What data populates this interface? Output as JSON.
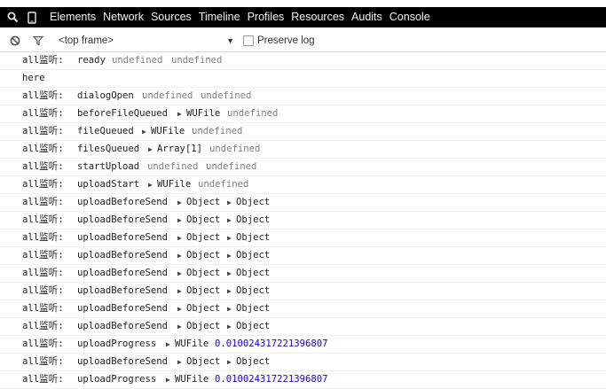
{
  "tabs": [
    "Elements",
    "Network",
    "Sources",
    "Timeline",
    "Profiles",
    "Resources",
    "Audits",
    "Console"
  ],
  "filter": {
    "frame": "<top frame>",
    "preserve_log_label": "Preserve log",
    "preserve_log_checked": false
  },
  "console_rows": [
    {
      "label": "all监听:",
      "event": "ready",
      "args": [
        {
          "text": "undefined",
          "kind": "undef"
        },
        {
          "text": "undefined",
          "kind": "undef"
        }
      ]
    },
    {
      "label": "here",
      "event": "",
      "args": []
    },
    {
      "label": "all监听:",
      "event": "dialogOpen",
      "args": [
        {
          "text": "undefined",
          "kind": "undef"
        },
        {
          "text": "undefined",
          "kind": "undef"
        }
      ]
    },
    {
      "label": "all监听:",
      "event": "beforeFileQueued",
      "args": [
        {
          "text": "WUFile",
          "kind": "object"
        },
        {
          "text": "undefined",
          "kind": "undef"
        }
      ]
    },
    {
      "label": "all监听:",
      "event": "fileQueued",
      "args": [
        {
          "text": "WUFile",
          "kind": "object"
        },
        {
          "text": "undefined",
          "kind": "undef"
        }
      ]
    },
    {
      "label": "all监听:",
      "event": "filesQueued",
      "args": [
        {
          "text": "Array[1]",
          "kind": "object"
        },
        {
          "text": "undefined",
          "kind": "undef"
        }
      ]
    },
    {
      "label": "all监听:",
      "event": "startUpload",
      "args": [
        {
          "text": "undefined",
          "kind": "undef"
        },
        {
          "text": "undefined",
          "kind": "undef"
        }
      ]
    },
    {
      "label": "all监听:",
      "event": "uploadStart",
      "args": [
        {
          "text": "WUFile",
          "kind": "object"
        },
        {
          "text": "undefined",
          "kind": "undef"
        }
      ]
    },
    {
      "label": "all监听:",
      "event": "uploadBeforeSend",
      "args": [
        {
          "text": "Object",
          "kind": "object"
        },
        {
          "text": "Object",
          "kind": "object"
        }
      ]
    },
    {
      "label": "all监听:",
      "event": "uploadBeforeSend",
      "args": [
        {
          "text": "Object",
          "kind": "object"
        },
        {
          "text": "Object",
          "kind": "object"
        }
      ]
    },
    {
      "label": "all监听:",
      "event": "uploadBeforeSend",
      "args": [
        {
          "text": "Object",
          "kind": "object"
        },
        {
          "text": "Object",
          "kind": "object"
        }
      ]
    },
    {
      "label": "all监听:",
      "event": "uploadBeforeSend",
      "args": [
        {
          "text": "Object",
          "kind": "object"
        },
        {
          "text": "Object",
          "kind": "object"
        }
      ]
    },
    {
      "label": "all监听:",
      "event": "uploadBeforeSend",
      "args": [
        {
          "text": "Object",
          "kind": "object"
        },
        {
          "text": "Object",
          "kind": "object"
        }
      ]
    },
    {
      "label": "all监听:",
      "event": "uploadBeforeSend",
      "args": [
        {
          "text": "Object",
          "kind": "object"
        },
        {
          "text": "Object",
          "kind": "object"
        }
      ]
    },
    {
      "label": "all监听:",
      "event": "uploadBeforeSend",
      "args": [
        {
          "text": "Object",
          "kind": "object"
        },
        {
          "text": "Object",
          "kind": "object"
        }
      ]
    },
    {
      "label": "all监听:",
      "event": "uploadBeforeSend",
      "args": [
        {
          "text": "Object",
          "kind": "object"
        },
        {
          "text": "Object",
          "kind": "object"
        }
      ]
    },
    {
      "label": "all监听:",
      "event": "uploadProgress",
      "args": [
        {
          "text": "WUFile",
          "kind": "object"
        },
        {
          "text": "0.010024317221396807",
          "kind": "number"
        }
      ]
    },
    {
      "label": "all监听:",
      "event": "uploadBeforeSend",
      "args": [
        {
          "text": "Object",
          "kind": "object"
        },
        {
          "text": "Object",
          "kind": "object"
        }
      ]
    },
    {
      "label": "all监听:",
      "event": "uploadProgress",
      "args": [
        {
          "text": "WUFile",
          "kind": "object"
        },
        {
          "text": "0.010024317221396807",
          "kind": "number"
        }
      ]
    }
  ],
  "icons": {
    "search": "search-icon",
    "device": "device-mode-icon",
    "clear": "clear-console-icon",
    "filter": "filter-icon",
    "dropdown": "dropdown-arrow-icon"
  }
}
